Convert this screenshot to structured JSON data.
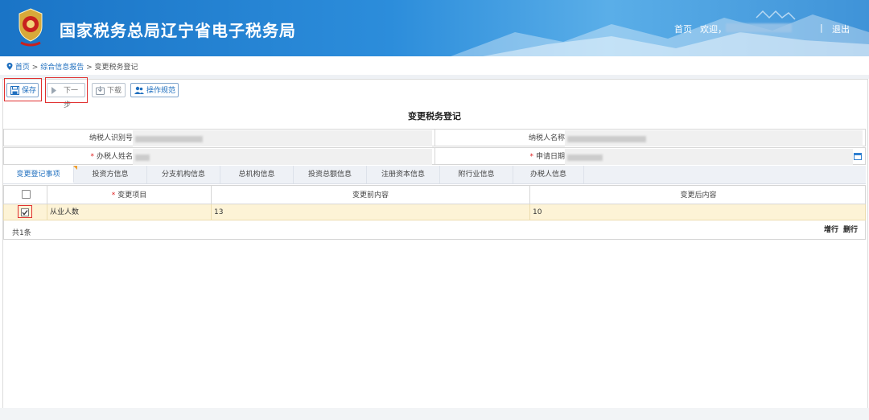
{
  "header": {
    "site_title": "国家税务总局辽宁省电子税务局",
    "home": "首页",
    "welcome": "欢迎，",
    "separator": "|",
    "logout": "退出"
  },
  "breadcrumb": {
    "home": "首页",
    "sep1": ">",
    "level1": "综合信息报告",
    "sep2": ">",
    "current": "变更税务登记"
  },
  "toolbar": {
    "save": "保存",
    "next": "下一步",
    "download": "下载",
    "guide": "操作规范"
  },
  "form": {
    "title": "变更税务登记",
    "taxpayer_id_label": "纳税人识别号",
    "taxpayer_name_label": "纳税人名称",
    "handler_name_label": "办税人姓名",
    "apply_date_label": "申请日期",
    "required_mark": "*"
  },
  "tabs": [
    {
      "label": "变更登记事项",
      "active": true
    },
    {
      "label": "投资方信息"
    },
    {
      "label": "分支机构信息"
    },
    {
      "label": "总机构信息"
    },
    {
      "label": "投资总额信息"
    },
    {
      "label": "注册资本信息"
    },
    {
      "label": "附行业信息"
    },
    {
      "label": "办税人信息"
    }
  ],
  "grid": {
    "columns": [
      "变更项目",
      "变更前内容",
      "变更后内容"
    ],
    "rows": [
      {
        "item": "从业人数",
        "before": "13",
        "after": "10",
        "checked": true
      }
    ],
    "count": "共1条",
    "add_row": "增行",
    "delete_row": "删行"
  },
  "colors": {
    "header_blue": "#2c8ddb",
    "link_blue": "#1f6fbf",
    "highlight_row": "#fdf3d6",
    "annotation_red": "#e03030",
    "required_red": "#e02020"
  }
}
